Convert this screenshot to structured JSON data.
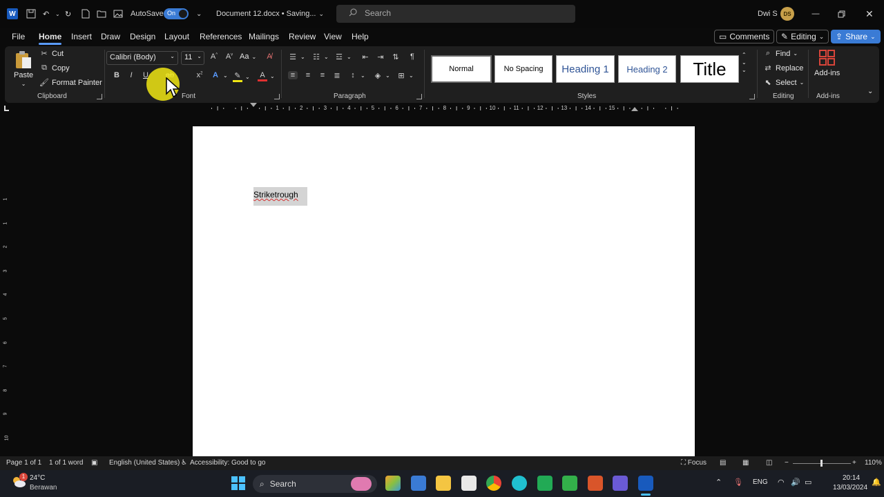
{
  "titlebar": {
    "autosave_label": "AutoSave",
    "autosave_state": "On",
    "doc_title": "Document 12.docx • Saving...",
    "search_placeholder": "Search",
    "user_name": "Dwi S",
    "user_initials": "DS"
  },
  "tabs": [
    "File",
    "Home",
    "Insert",
    "Draw",
    "Design",
    "Layout",
    "References",
    "Mailings",
    "Review",
    "View",
    "Help"
  ],
  "active_tab": "Home",
  "top_actions": {
    "comments": "Comments",
    "editing": "Editing",
    "share": "Share"
  },
  "ribbon": {
    "clipboard": {
      "paste": "Paste",
      "cut": "Cut",
      "copy": "Copy",
      "format_painter": "Format Painter",
      "label": "Clipboard"
    },
    "font": {
      "font_name": "Calibri (Body)",
      "font_size": "11",
      "label": "Font",
      "change_case": "Aa"
    },
    "paragraph": {
      "label": "Paragraph"
    },
    "styles": {
      "label": "Styles",
      "items": [
        "Normal",
        "No Spacing",
        "Heading 1",
        "Heading 2",
        "Title"
      ]
    },
    "editing": {
      "find": "Find",
      "replace": "Replace",
      "select": "Select",
      "label": "Editing"
    },
    "addins": {
      "button": "Add-ins",
      "label": "Add-ins"
    }
  },
  "ruler_numbers": [
    "1",
    "2",
    "3",
    "4",
    "5",
    "6",
    "7",
    "8",
    "9",
    "10",
    "11",
    "12",
    "13",
    "14",
    "15"
  ],
  "vruler_numbers": [
    "1",
    "1",
    "2",
    "3",
    "4",
    "5",
    "6",
    "7",
    "8",
    "9",
    "10",
    "11"
  ],
  "document": {
    "text": "Striketrough"
  },
  "statusbar": {
    "page": "Page 1 of 1",
    "words": "1 of 1 word",
    "language": "English (United States)",
    "accessibility": "Accessibility: Good to go",
    "focus": "Focus",
    "zoom": "110%"
  },
  "taskbar": {
    "weather_temp": "24°C",
    "weather_desc": "Berawan",
    "notification_count": "1",
    "search": "Search",
    "lang": "ENG",
    "time": "20:14",
    "date": "13/03/2024"
  },
  "colors": {
    "accent": "#3a7bd5",
    "word_blue": "#185abd",
    "highlight": "#f0e614"
  }
}
